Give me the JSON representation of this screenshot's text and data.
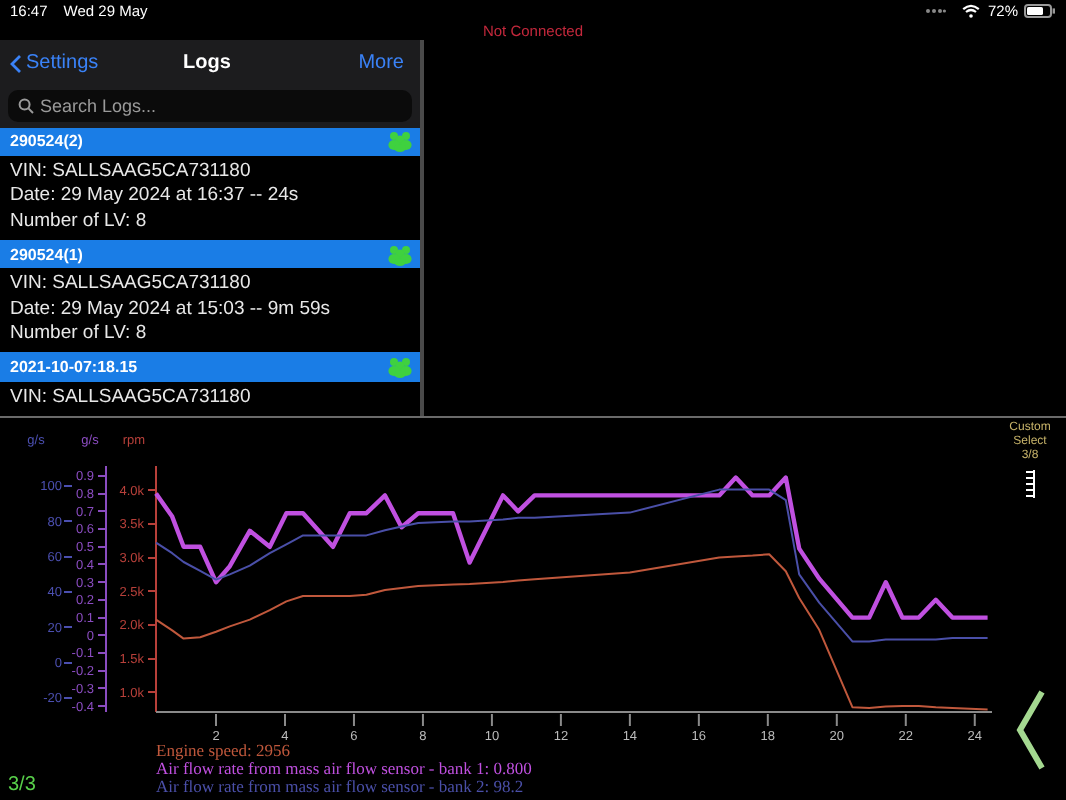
{
  "status_bar": {
    "time": "16:47",
    "date": "Wed 29 May",
    "battery": "72%"
  },
  "connection": "Not Connected",
  "logs_panel": {
    "back": "Settings",
    "title": "Logs",
    "action": "More",
    "search": {
      "placeholder": "Search Logs..."
    },
    "logs": [
      {
        "name": "290524(2)",
        "lines": [
          "VIN: SALLSAAG5CA731180",
          "Date: 29 May 2024 at 16:37 -- 24s",
          "Number of LV: 8"
        ]
      },
      {
        "name": "290524(1)",
        "lines": [
          "VIN: SALLSAAG5CA731180",
          "Date: 29 May 2024 at 15:03 -- 9m 59s",
          "Number of LV: 8"
        ]
      },
      {
        "name": "2021-10-07:18.15",
        "lines": [
          "VIN: SALLSAAG5CA731180"
        ]
      }
    ]
  },
  "chart": {
    "chart_data": {
      "type": "line",
      "xlim": [
        0.26,
        24.5
      ],
      "xticks": [
        2,
        4,
        6,
        8,
        10,
        12,
        14,
        16,
        18,
        20,
        22,
        24
      ],
      "ylabel": "rpm",
      "ylim": [
        0.71,
        4.36
      ],
      "yticks": [
        {
          "value": 4.0,
          "label": "4.0k"
        },
        {
          "value": 3.5,
          "label": "3.5k"
        },
        {
          "value": 3.0,
          "label": "3.0k"
        },
        {
          "value": 2.5,
          "label": "2.5k"
        },
        {
          "value": 2.0,
          "label": "2.0k"
        },
        {
          "value": 1.5,
          "label": "1.5k"
        },
        {
          "value": 1.0,
          "label": "1.0k"
        }
      ],
      "y2label": "g/s",
      "y2lim": [
        -0.433,
        0.956
      ],
      "y2ticks": [
        0.9,
        0.8,
        0.7,
        0.6,
        0.5,
        0.4,
        0.3,
        0.2,
        0.1,
        0,
        -0.1,
        -0.2,
        -0.3,
        -0.4
      ],
      "y3label": "g/s",
      "y3lim": [
        -20,
        100
      ],
      "y3ticks": [
        100,
        80,
        60,
        40,
        20,
        0,
        -20
      ],
      "x": [
        0.26,
        0.73,
        1.06,
        1.54,
        2.0,
        2.4,
        2.98,
        3.56,
        4.04,
        4.52,
        5.39,
        5.88,
        6.36,
        6.9,
        7.38,
        7.86,
        8.87,
        9.35,
        10.32,
        10.76,
        11.24,
        14,
        16.59,
        17.07,
        17.56,
        18.04,
        18.52,
        18.91,
        19.49,
        20.45,
        20.94,
        21.42,
        21.9,
        22.38,
        22.87,
        23.35,
        24.37
      ],
      "series": [
        {
          "axis": "y",
          "color": "#c0583c",
          "values": [
            2.08,
            1.92,
            1.8,
            1.82,
            1.9,
            1.98,
            2.08,
            2.22,
            2.35,
            2.43,
            2.43,
            2.43,
            2.45,
            2.52,
            2.55,
            2.58,
            2.6,
            2.61,
            2.64,
            2.66,
            2.68,
            2.78,
            3.0,
            3.02,
            3.03,
            3.05,
            2.8,
            2.4,
            1.93,
            0.78,
            0.77,
            0.79,
            0.8,
            0.8,
            0.78,
            0.77,
            0.75
          ]
        },
        {
          "axis": "y2",
          "color": "#c050e0",
          "values": [
            0.8,
            0.67,
            0.5,
            0.5,
            0.3,
            0.39,
            0.59,
            0.5,
            0.69,
            0.69,
            0.5,
            0.69,
            0.69,
            0.79,
            0.61,
            0.69,
            0.69,
            0.41,
            0.79,
            0.7,
            0.79,
            0.79,
            0.79,
            0.89,
            0.79,
            0.79,
            0.89,
            0.49,
            0.32,
            0.1,
            0.1,
            0.3,
            0.1,
            0.1,
            0.2,
            0.1,
            0.1
          ]
        },
        {
          "axis": "y3",
          "color": "#4a4fa8",
          "values": [
            68,
            62,
            57,
            52,
            47,
            50,
            55,
            62,
            67,
            72,
            72,
            72,
            72,
            75,
            77,
            79,
            80,
            80,
            81,
            82,
            82,
            85,
            98,
            98,
            98,
            98,
            92,
            50,
            34,
            12,
            12,
            13,
            13,
            13,
            13,
            14,
            14
          ]
        }
      ]
    },
    "legend": [
      "Engine speed: 2956",
      "Air flow rate from mass air flow sensor - bank 1: 0.800",
      "Air flow rate from mass air flow sensor - bank 2: 98.2"
    ],
    "page_counter": "3/3",
    "selector": [
      "Custom",
      "Select",
      "3/8"
    ]
  }
}
